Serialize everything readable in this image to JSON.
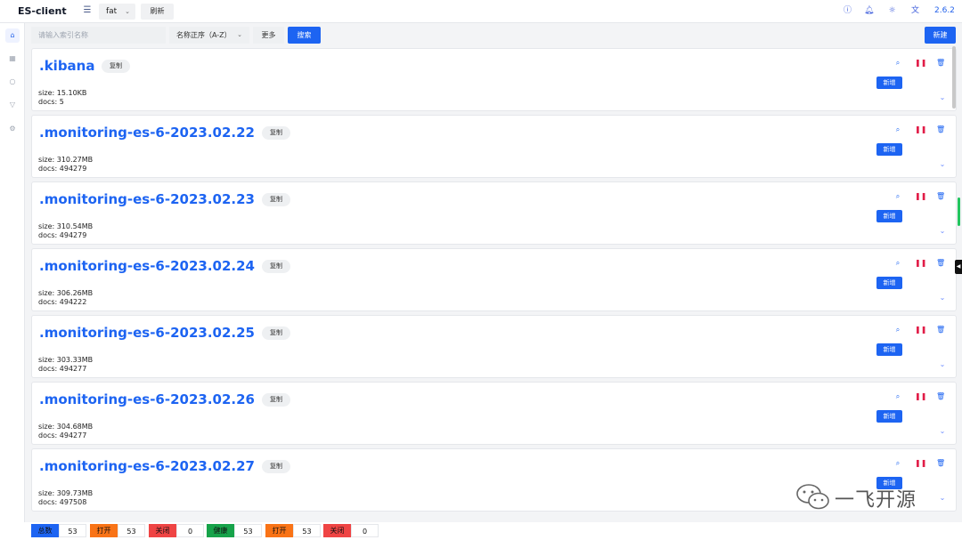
{
  "app": {
    "title": "ES-client",
    "environment": "fat",
    "refresh_label": "刷新",
    "version": "2.6.2",
    "accent": "#1d64f2"
  },
  "header_icons": [
    "info-icon",
    "bell-icon",
    "sun-icon",
    "translate-icon"
  ],
  "sidebar": {
    "items": [
      "home-icon",
      "grid-icon",
      "search-icon",
      "filter-icon",
      "settings-icon"
    ],
    "active": "home-icon"
  },
  "toolbar": {
    "search_placeholder": "请输入索引名称",
    "sort_label": "名称正序（A-Z）",
    "more_label": "更多",
    "search_label": "搜索",
    "new_label": "新建"
  },
  "card_labels": {
    "copy": "复制",
    "add": "新增",
    "size_prefix": "size: ",
    "docs_prefix": "docs: "
  },
  "indices": [
    {
      "name": ".kibana",
      "size": "15.10KB",
      "docs": "5"
    },
    {
      "name": ".monitoring-es-6-2023.02.22",
      "size": "310.27MB",
      "docs": "494279"
    },
    {
      "name": ".monitoring-es-6-2023.02.23",
      "size": "310.54MB",
      "docs": "494279"
    },
    {
      "name": ".monitoring-es-6-2023.02.24",
      "size": "306.26MB",
      "docs": "494222"
    },
    {
      "name": ".monitoring-es-6-2023.02.25",
      "size": "303.33MB",
      "docs": "494277"
    },
    {
      "name": ".monitoring-es-6-2023.02.26",
      "size": "304.68MB",
      "docs": "494277"
    },
    {
      "name": ".monitoring-es-6-2023.02.27",
      "size": "309.73MB",
      "docs": "497508"
    }
  ],
  "status": [
    {
      "label": "总数",
      "value": "53",
      "color": "#1d64f2"
    },
    {
      "label": "打开",
      "value": "53",
      "color": "#f97316"
    },
    {
      "label": "关闭",
      "value": "0",
      "color": "#ef4444"
    },
    {
      "label": "健康",
      "value": "53",
      "color": "#16a34a"
    },
    {
      "label": "打开",
      "value": "53",
      "color": "#f97316"
    },
    {
      "label": "关闭",
      "value": "0",
      "color": "#ef4444"
    }
  ],
  "watermark": {
    "text": "一飞开源"
  }
}
